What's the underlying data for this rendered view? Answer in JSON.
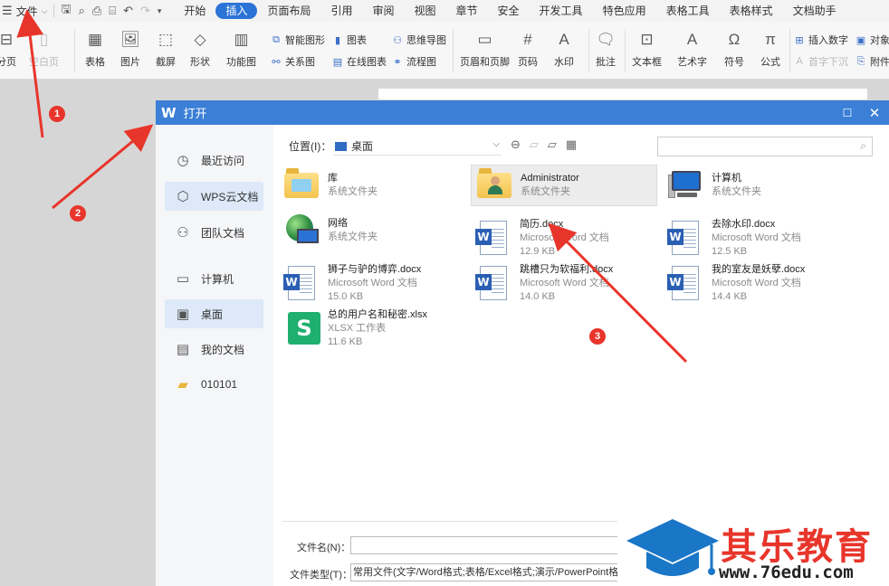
{
  "menubar": {
    "file_label": "文件",
    "tabs": [
      {
        "label": "开始",
        "active": false
      },
      {
        "label": "插入",
        "active": true
      },
      {
        "label": "页面布局",
        "active": false
      },
      {
        "label": "引用",
        "active": false
      },
      {
        "label": "审阅",
        "active": false
      },
      {
        "label": "视图",
        "active": false
      },
      {
        "label": "章节",
        "active": false
      },
      {
        "label": "安全",
        "active": false
      },
      {
        "label": "开发工具",
        "active": false
      },
      {
        "label": "特色应用",
        "active": false
      },
      {
        "label": "表格工具",
        "active": false
      },
      {
        "label": "表格样式",
        "active": false
      },
      {
        "label": "文档助手",
        "active": false
      }
    ]
  },
  "ribbon": {
    "page_break": "分页",
    "blank_page": "空白页",
    "table": "表格",
    "picture": "图片",
    "screenshot": "截屏",
    "shape": "形状",
    "function_chart": "功能图",
    "smart_art": "智能图形",
    "chart": "图表",
    "relation": "关系图",
    "online_chart": "在线图表",
    "mind_map": "思维导图",
    "flowchart": "流程图",
    "header_footer": "页眉和页脚",
    "page_number": "页码",
    "watermark": "水印",
    "comment": "批注",
    "textbox": "文本框",
    "art_text": "艺术字",
    "symbol": "符号",
    "formula": "公式",
    "insert_number": "插入数字",
    "object": "对象",
    "drop_cap": "首字下沉",
    "attachment": "附件"
  },
  "dialog": {
    "title": "打开",
    "logo": "W",
    "sidebar": [
      {
        "label": "最近访问",
        "icon": "clock-icon",
        "selected": false
      },
      {
        "label": "WPS云文档",
        "icon": "cube-icon",
        "selected": true
      },
      {
        "label": "团队文档",
        "icon": "team-icon",
        "selected": false
      },
      {
        "label": "计算机",
        "icon": "monitor-icon",
        "selected": false
      },
      {
        "label": "桌面",
        "icon": "desktop-icon",
        "selected": true
      },
      {
        "label": "我的文档",
        "icon": "my-docs-icon",
        "selected": false
      },
      {
        "label": "010101",
        "icon": "folder-icon",
        "selected": false
      }
    ],
    "location_label": "位置(I)：",
    "location_value": "桌面",
    "search_placeholder": "",
    "files": [
      {
        "name": "库",
        "desc": "系统文件夹",
        "size": "",
        "type": "library"
      },
      {
        "name": "Administrator",
        "desc": "系统文件夹",
        "size": "",
        "type": "admin"
      },
      {
        "name": "计算机",
        "desc": "系统文件夹",
        "size": "",
        "type": "computer"
      },
      {
        "name": "网络",
        "desc": "系统文件夹",
        "size": "",
        "type": "network"
      },
      {
        "name": "简历.docx",
        "desc": "Microsoft Word 文档",
        "size": "12.9 KB",
        "type": "docx"
      },
      {
        "name": "去除水印.docx",
        "desc": "Microsoft Word 文档",
        "size": "12.5 KB",
        "type": "docx"
      },
      {
        "name": "狮子与驴的博弈.docx",
        "desc": "Microsoft Word 文档",
        "size": "15.0 KB",
        "type": "docx"
      },
      {
        "name": "跳槽只为软福利.docx",
        "desc": "Microsoft Word 文档",
        "size": "14.0 KB",
        "type": "docx"
      },
      {
        "name": "我的室友是妖孽.docx",
        "desc": "Microsoft Word 文档",
        "size": "14.4 KB",
        "type": "docx"
      },
      {
        "name": "总的用户名和秘密.xlsx",
        "desc": "XLSX 工作表",
        "size": "11.6 KB",
        "type": "xlsx"
      }
    ],
    "filename_label": "文件名(N)：",
    "filename_value": "",
    "filetype_label": "文件类型(T)：",
    "filetype_value": "常用文件(文字/Word格式;表格/Excel格式;演示/PowerPoint格式;"
  },
  "annotations": [
    "1",
    "2",
    "3"
  ],
  "watermark": {
    "brand": "其乐教育",
    "url": "www.76edu.com"
  },
  "colors": {
    "accent": "#2b73d6",
    "dialog_title": "#3b7fd6",
    "annotation": "#e8352b"
  }
}
